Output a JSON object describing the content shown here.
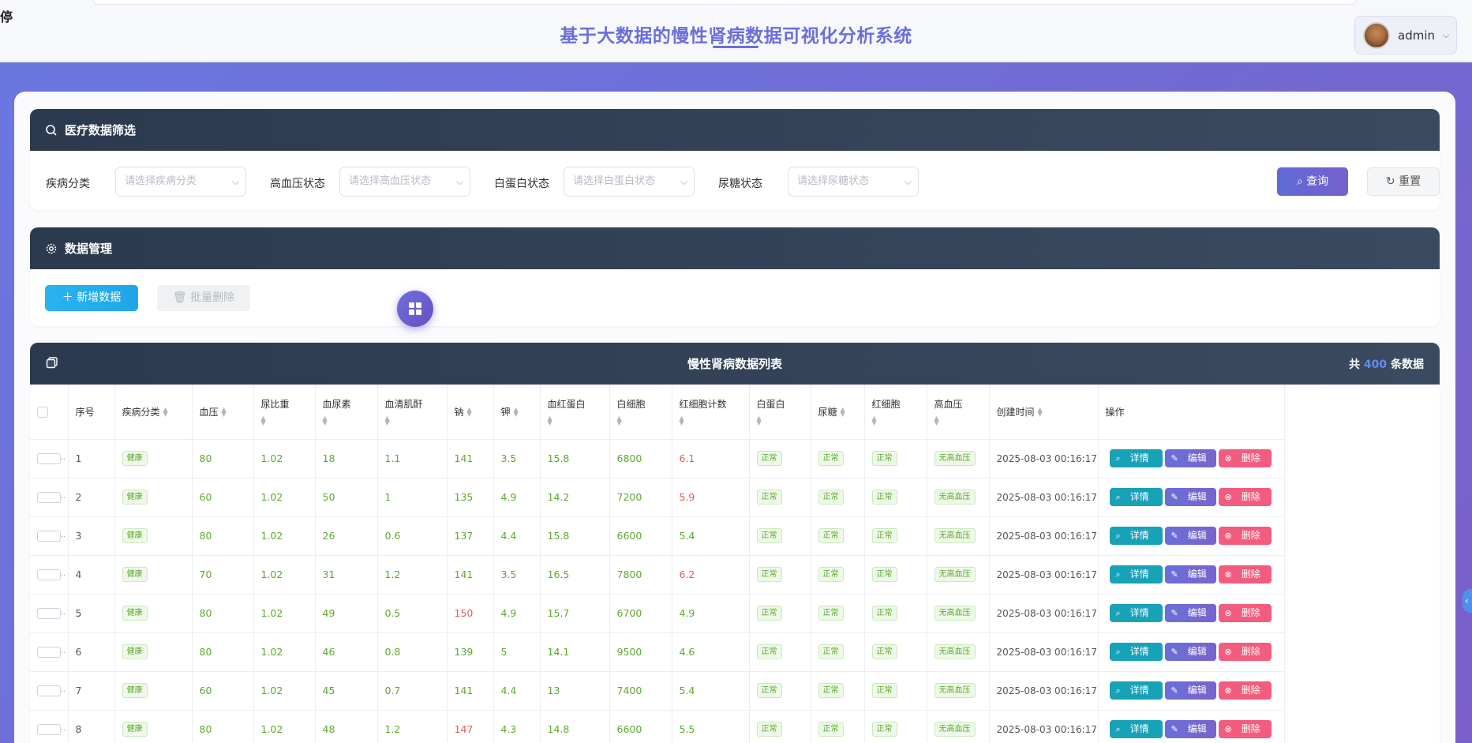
{
  "header": {
    "corner_glyph": "停",
    "title": "基于大数据的慢性肾病数据可视化分析系统",
    "user_name": "admin"
  },
  "filter_panel": {
    "title": "医疗数据筛选",
    "fields": [
      {
        "label": "疾病分类",
        "placeholder": "请选择疾病分类"
      },
      {
        "label": "高血压状态",
        "placeholder": "请选择高血压状态"
      },
      {
        "label": "白蛋白状态",
        "placeholder": "请选择白蛋白状态"
      },
      {
        "label": "尿糖状态",
        "placeholder": "请选择尿糖状态"
      }
    ],
    "query_label": "查询",
    "reset_label": "重置"
  },
  "manage_panel": {
    "title": "数据管理",
    "add_label": "新增数据",
    "batch_delete_label": "批量删除"
  },
  "table": {
    "title": "慢性肾病数据列表",
    "count_prefix": "共",
    "count": "400",
    "count_suffix": "条数据",
    "columns": [
      "序号",
      "疾病分类",
      "血压",
      "尿比重",
      "血尿素",
      "血清肌酐",
      "钠",
      "钾",
      "血红蛋白",
      "白细胞",
      "红细胞计数",
      "白蛋白",
      "尿糖",
      "红细胞",
      "高血压",
      "创建时间",
      "操作"
    ],
    "actions": {
      "detail": "详情",
      "edit": "编辑",
      "delete": "删除"
    },
    "rows": [
      [
        "1",
        "健康",
        "80",
        "1.02",
        "18",
        "1.1",
        "141",
        "3.5",
        "15.8",
        "6800",
        "6.1",
        "正常",
        "正常",
        "正常",
        "无高血压",
        "2025-08-03 00:16:17"
      ],
      [
        "2",
        "健康",
        "60",
        "1.02",
        "50",
        "1",
        "135",
        "4.9",
        "14.2",
        "7200",
        "5.9",
        "正常",
        "正常",
        "正常",
        "无高血压",
        "2025-08-03 00:16:17"
      ],
      [
        "3",
        "健康",
        "80",
        "1.02",
        "26",
        "0.6",
        "137",
        "4.4",
        "15.8",
        "6600",
        "5.4",
        "正常",
        "正常",
        "正常",
        "无高血压",
        "2025-08-03 00:16:17"
      ],
      [
        "4",
        "健康",
        "70",
        "1.02",
        "31",
        "1.2",
        "141",
        "3.5",
        "16.5",
        "7800",
        "6.2",
        "正常",
        "正常",
        "正常",
        "无高血压",
        "2025-08-03 00:16:17"
      ],
      [
        "5",
        "健康",
        "80",
        "1.02",
        "49",
        "0.5",
        "150",
        "4.9",
        "15.7",
        "6700",
        "4.9",
        "正常",
        "正常",
        "正常",
        "无高血压",
        "2025-08-03 00:16:17"
      ],
      [
        "6",
        "健康",
        "80",
        "1.02",
        "46",
        "0.8",
        "139",
        "5",
        "14.1",
        "9500",
        "4.6",
        "正常",
        "正常",
        "正常",
        "无高血压",
        "2025-08-03 00:16:17"
      ],
      [
        "7",
        "健康",
        "60",
        "1.02",
        "45",
        "0.7",
        "141",
        "4.4",
        "13",
        "7400",
        "5.4",
        "正常",
        "正常",
        "正常",
        "无高血压",
        "2025-08-03 00:16:17"
      ],
      [
        "8",
        "健康",
        "80",
        "1.02",
        "48",
        "1.2",
        "147",
        "4.3",
        "14.8",
        "6600",
        "5.5",
        "正常",
        "正常",
        "正常",
        "无高血压",
        "2025-08-03 00:16:17"
      ]
    ],
    "highlight_red": [
      [
        0,
        10
      ],
      [
        1,
        10
      ],
      [
        3,
        10
      ],
      [
        4,
        6
      ],
      [
        7,
        6
      ]
    ]
  },
  "colors": {
    "accent": "#6a6fd8",
    "header_dark": "#2c3a4f",
    "normal_value": "#5aaa2c",
    "abnormal_value": "#e25a5a",
    "detail": "#17a2b8",
    "delete": "#f25c7e"
  },
  "icons": [
    "search-icon",
    "gear-icon",
    "plus-icon",
    "trash-icon",
    "refresh-icon",
    "grid-icon",
    "copy-icon",
    "chevron-down-icon",
    "edit-icon",
    "close-circle-icon"
  ]
}
